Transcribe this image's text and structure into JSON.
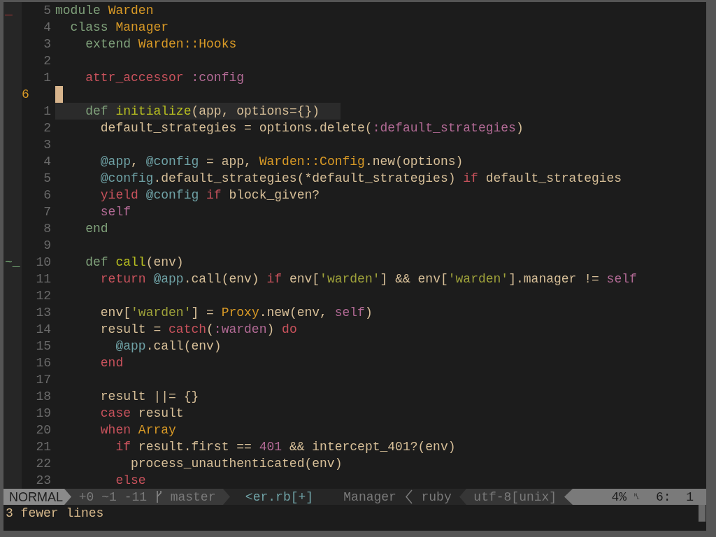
{
  "editor": {
    "lines": [
      {
        "number": "5",
        "sign": {
          "kind": "removed",
          "text": "_"
        },
        "tokens": [
          {
            "kind": "keyword",
            "text": "module "
          },
          {
            "kind": "constant",
            "text": "Warden"
          }
        ]
      },
      {
        "number": "4",
        "tokens": [
          {
            "kind": "keyword",
            "text": "  class "
          },
          {
            "kind": "constant",
            "text": "Manager"
          }
        ]
      },
      {
        "number": "3",
        "tokens": [
          {
            "kind": "keyword",
            "text": "    extend "
          },
          {
            "kind": "constant",
            "text": "Warden::Hooks"
          }
        ]
      },
      {
        "number": "2"
      },
      {
        "number": "1",
        "tokens": [
          {
            "kind": "control",
            "text": "    attr_accessor "
          },
          {
            "kind": "symbol",
            "text": ":config"
          }
        ]
      },
      {
        "number": "6",
        "current": true
      },
      {
        "number": "1",
        "highlighted": true,
        "tokens": [
          {
            "kind": "keyword",
            "text": "    def "
          },
          {
            "kind": "function",
            "text": "initialize"
          },
          {
            "kind": "plain",
            "text": "(app, options={})"
          }
        ]
      },
      {
        "number": "2",
        "tokens": [
          {
            "kind": "plain",
            "text": "      default_strategies = options.delete("
          },
          {
            "kind": "symbol",
            "text": ":default_strategies"
          },
          {
            "kind": "plain",
            "text": ")"
          }
        ]
      },
      {
        "number": "3"
      },
      {
        "number": "4",
        "tokens": [
          {
            "kind": "ivar",
            "text": "      @app"
          },
          {
            "kind": "plain",
            "text": ", "
          },
          {
            "kind": "ivar",
            "text": "@config"
          },
          {
            "kind": "plain",
            "text": " = app, "
          },
          {
            "kind": "constant",
            "text": "Warden::Config"
          },
          {
            "kind": "plain",
            "text": ".new(options)"
          }
        ]
      },
      {
        "number": "5",
        "tokens": [
          {
            "kind": "ivar",
            "text": "      @config"
          },
          {
            "kind": "plain",
            "text": ".default_strategies(*default_strategies) "
          },
          {
            "kind": "control",
            "text": "if"
          },
          {
            "kind": "plain",
            "text": " default_strategies"
          }
        ]
      },
      {
        "number": "6",
        "tokens": [
          {
            "kind": "control",
            "text": "      yield "
          },
          {
            "kind": "ivar",
            "text": "@config "
          },
          {
            "kind": "control",
            "text": "if"
          },
          {
            "kind": "plain",
            "text": " block_given?"
          }
        ]
      },
      {
        "number": "7",
        "tokens": [
          {
            "kind": "symbol",
            "text": "      self"
          }
        ]
      },
      {
        "number": "8",
        "tokens": [
          {
            "kind": "keyword",
            "text": "    end"
          }
        ]
      },
      {
        "number": "9"
      },
      {
        "number": "10",
        "sign": {
          "kind": "changed",
          "text": "~_"
        },
        "tokens": [
          {
            "kind": "keyword",
            "text": "    def "
          },
          {
            "kind": "function",
            "text": "call"
          },
          {
            "kind": "plain",
            "text": "(env)"
          }
        ]
      },
      {
        "number": "11",
        "tokens": [
          {
            "kind": "control",
            "text": "      return "
          },
          {
            "kind": "ivar",
            "text": "@app"
          },
          {
            "kind": "plain",
            "text": ".call(env) "
          },
          {
            "kind": "control",
            "text": "if"
          },
          {
            "kind": "plain",
            "text": " env["
          },
          {
            "kind": "string",
            "text": "'warden'"
          },
          {
            "kind": "plain",
            "text": "] && env["
          },
          {
            "kind": "string",
            "text": "'warden'"
          },
          {
            "kind": "plain",
            "text": "].manager != "
          },
          {
            "kind": "symbol",
            "text": "self"
          }
        ]
      },
      {
        "number": "12"
      },
      {
        "number": "13",
        "tokens": [
          {
            "kind": "plain",
            "text": "      env["
          },
          {
            "kind": "string",
            "text": "'warden'"
          },
          {
            "kind": "plain",
            "text": "] = "
          },
          {
            "kind": "constant",
            "text": "Proxy"
          },
          {
            "kind": "plain",
            "text": ".new(env, "
          },
          {
            "kind": "symbol",
            "text": "self"
          },
          {
            "kind": "plain",
            "text": ")"
          }
        ]
      },
      {
        "number": "14",
        "tokens": [
          {
            "kind": "plain",
            "text": "      result = "
          },
          {
            "kind": "control",
            "text": "catch"
          },
          {
            "kind": "plain",
            "text": "("
          },
          {
            "kind": "symbol",
            "text": ":warden"
          },
          {
            "kind": "plain",
            "text": ") "
          },
          {
            "kind": "control",
            "text": "do"
          }
        ]
      },
      {
        "number": "15",
        "tokens": [
          {
            "kind": "ivar",
            "text": "        @app"
          },
          {
            "kind": "plain",
            "text": ".call(env)"
          }
        ]
      },
      {
        "number": "16",
        "tokens": [
          {
            "kind": "control",
            "text": "      end"
          }
        ]
      },
      {
        "number": "17"
      },
      {
        "number": "18",
        "tokens": [
          {
            "kind": "plain",
            "text": "      result ||= {}"
          }
        ]
      },
      {
        "number": "19",
        "tokens": [
          {
            "kind": "control",
            "text": "      case"
          },
          {
            "kind": "plain",
            "text": " result"
          }
        ]
      },
      {
        "number": "20",
        "tokens": [
          {
            "kind": "control",
            "text": "      when "
          },
          {
            "kind": "constant",
            "text": "Array"
          }
        ]
      },
      {
        "number": "21",
        "tokens": [
          {
            "kind": "control",
            "text": "        if"
          },
          {
            "kind": "plain",
            "text": " result.first == "
          },
          {
            "kind": "symbol",
            "text": "401"
          },
          {
            "kind": "plain",
            "text": " && intercept_401?(env)"
          }
        ]
      },
      {
        "number": "22",
        "tokens": [
          {
            "kind": "plain",
            "text": "          process_unauthenticated(env)"
          }
        ]
      },
      {
        "number": "23",
        "tokens": [
          {
            "kind": "control",
            "text": "        else"
          }
        ]
      }
    ]
  },
  "status_bar": {
    "mode": "NORMAL",
    "diff": "+0 ~1 -11",
    "branch": "master",
    "file": "<er.rb[+]",
    "scope": "Manager",
    "filetype": "ruby",
    "encoding": "utf-8[unix]",
    "percent": "4%",
    "line_glyph": "␤",
    "position": "6:  1"
  },
  "message": "3 fewer lines"
}
